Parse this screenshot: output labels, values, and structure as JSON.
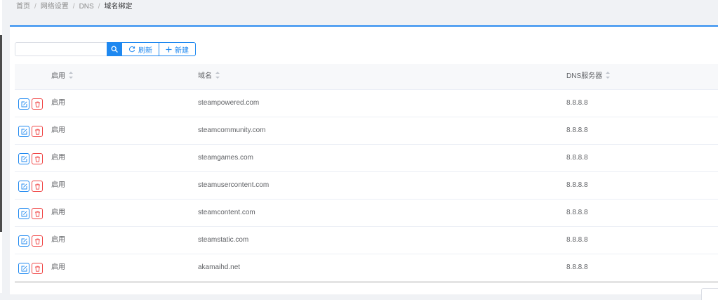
{
  "breadcrumb": [
    {
      "label": "首页"
    },
    {
      "label": "网络设置"
    },
    {
      "label": "DNS"
    },
    {
      "label": "域名绑定"
    }
  ],
  "breadcrumb_separator": "/",
  "toolbar": {
    "search_placeholder": "",
    "search_value": "",
    "search_icon": "search-icon",
    "refresh_label": "刷新",
    "refresh_icon": "refresh-icon",
    "new_label": "新建",
    "new_icon": "plus-icon"
  },
  "table": {
    "columns": [
      {
        "label": "启用"
      },
      {
        "label": "域名"
      },
      {
        "label": "DNS服务器"
      }
    ],
    "rows": [
      {
        "enabled": "启用",
        "domain": "steampowered.com",
        "dns": "8.8.8.8"
      },
      {
        "enabled": "启用",
        "domain": "steamcommunity.com",
        "dns": "8.8.8.8"
      },
      {
        "enabled": "启用",
        "domain": "steamgames.com",
        "dns": "8.8.8.8"
      },
      {
        "enabled": "启用",
        "domain": "steamusercontent.com",
        "dns": "8.8.8.8"
      },
      {
        "enabled": "启用",
        "domain": "steamcontent.com",
        "dns": "8.8.8.8"
      },
      {
        "enabled": "启用",
        "domain": "steamstatic.com",
        "dns": "8.8.8.8"
      },
      {
        "enabled": "启用",
        "domain": "akamaihd.net",
        "dns": "8.8.8.8"
      }
    ],
    "row_actions": [
      "edit-icon",
      "delete-icon"
    ]
  },
  "colors": {
    "accent": "#1e88f0",
    "danger": "#f04545",
    "header_bg": "#f7f8fa",
    "page_bg": "#f0f2f5"
  }
}
